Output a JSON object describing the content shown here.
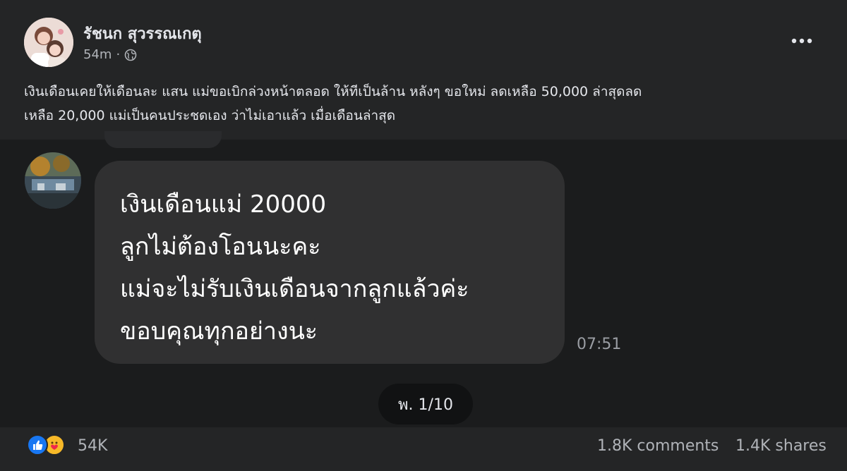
{
  "post": {
    "author": "รัชนก สุวรรณเกตุ",
    "time": "54m",
    "dot": "·",
    "more_icon": "more-horizontal-icon",
    "privacy_icon": "globe-icon",
    "caption_line1": "เงินเดือนเคยให้เดือนละ แสน แม่ขอเบิกล่วงหน้าตลอด ให้ทีเป็นล้าน  หลังๆ ขอใหม่ ลดเหลือ 50,000 ล่าสุดลด",
    "caption_line2": "เหลือ 20,000 แม่เป็นคนประชดเอง ว่าไม่เอาแล้ว เมื่อเดือนล่าสุด"
  },
  "message": {
    "lines": [
      "เงินเดือนแม่ 20000",
      "ลูกไม่ต้องโอนนะคะ",
      "แม่จะไม่รับเงินเดือนจากลูกแล้วค่ะ",
      "ขอบคุณทุกอย่างนะ"
    ],
    "timestamp": "07:51"
  },
  "pager": {
    "label": "พ. 1/10"
  },
  "footer": {
    "reaction_icons": [
      "like-icon",
      "care-icon"
    ],
    "reaction_count": "54K",
    "comments": "1.8K comments",
    "shares": "1.4K shares"
  },
  "colors": {
    "background": "#1b1c1d",
    "card": "#242526",
    "bubble": "#303031",
    "like_blue": "#1877f2",
    "care_yellow": "#f7b928"
  }
}
